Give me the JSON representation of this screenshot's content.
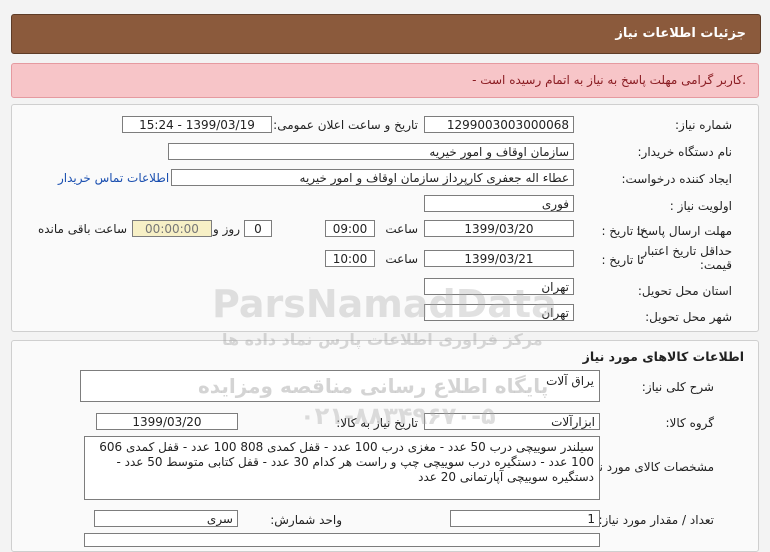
{
  "header": {
    "title": "جزئیات اطلاعات نیاز"
  },
  "alert": {
    "message": "- کاربر گرامی مهلت پاسخ به نیاز به اتمام رسیده است."
  },
  "info": {
    "need_number_label": "شماره نیاز:",
    "need_number": "1299003003000068",
    "announce_label": "تاریخ و ساعت اعلان عمومی:",
    "announce_value": "1399/03/19 - 15:24",
    "buyer_label": "نام دستگاه خریدار:",
    "buyer": "سازمان اوقاف و امور خیریه",
    "creator_label": "ایجاد کننده درخواست:",
    "creator": "عطاء اله جعفری کارپرداز سازمان اوقاف و امور خیریه",
    "contact_link": "اطلاعات تماس خریدار",
    "priority_label": "اولویت نیاز :",
    "priority": "فوری",
    "deadline_label": "مهلت ارسال پاسخ:",
    "to_date_label": "تا تاریخ :",
    "deadline_date": "1399/03/20",
    "time_label": "ساعت",
    "deadline_time": "09:00",
    "days_value": "0",
    "days_label": "روز و",
    "remaining_value": "00:00:00",
    "remaining_label": "ساعت باقی مانده",
    "validity_label_1": "حداقل تاریخ اعتبار",
    "validity_label_2": "قیمت:",
    "validity_to_label": "تا تاریخ :",
    "validity_date": "1399/03/21",
    "validity_time_label": "ساعت",
    "validity_time": "10:00",
    "province_label": "استان محل تحویل:",
    "province": "تهران",
    "city_label": "شهر محل تحویل:",
    "city": "تهران"
  },
  "goods": {
    "section_title": "اطلاعات کالاهای مورد نیاز",
    "summary_label": "شرح کلی نیاز:",
    "summary": "یراق آلات",
    "group_label": "گروه کالا:",
    "group": "ابزارآلات",
    "need_date_label": "تاریخ نیاز به کالا:",
    "need_date": "1399/03/20",
    "specs_label": "مشخصات کالای مورد نیاز:",
    "specs": "سیلندر سوییچی درب 50 عدد - مغزی درب 100 عدد - قفل کمدی 808 100 عدد - قفل کمدی 606 100 عدد - دستگیره درب سوییچی چپ و راست هر کدام 30 عدد - قفل کتابی متوسط 50 عدد - دستگیره سوییچی آپارتمانی 20 عدد",
    "quantity_label": "تعداد / مقدار مورد نیاز:",
    "quantity": "1",
    "unit_label": "واحد شمارش:",
    "unit": "سری"
  },
  "watermark": {
    "text1": "ParsNamadData",
    "text2": "مرکز فراوری اطلاعات پارس نماد داده ها",
    "text3": "پایگاه اطلاع رسانی مناقصه ومزایده",
    "text4": "۰۲۱-۸۸۳۴۹۶۷۰-۵"
  },
  "colors": {
    "header_bg": "#8b5a3c",
    "alert_bg": "#f7c5c8",
    "link": "#1a4fb0"
  }
}
